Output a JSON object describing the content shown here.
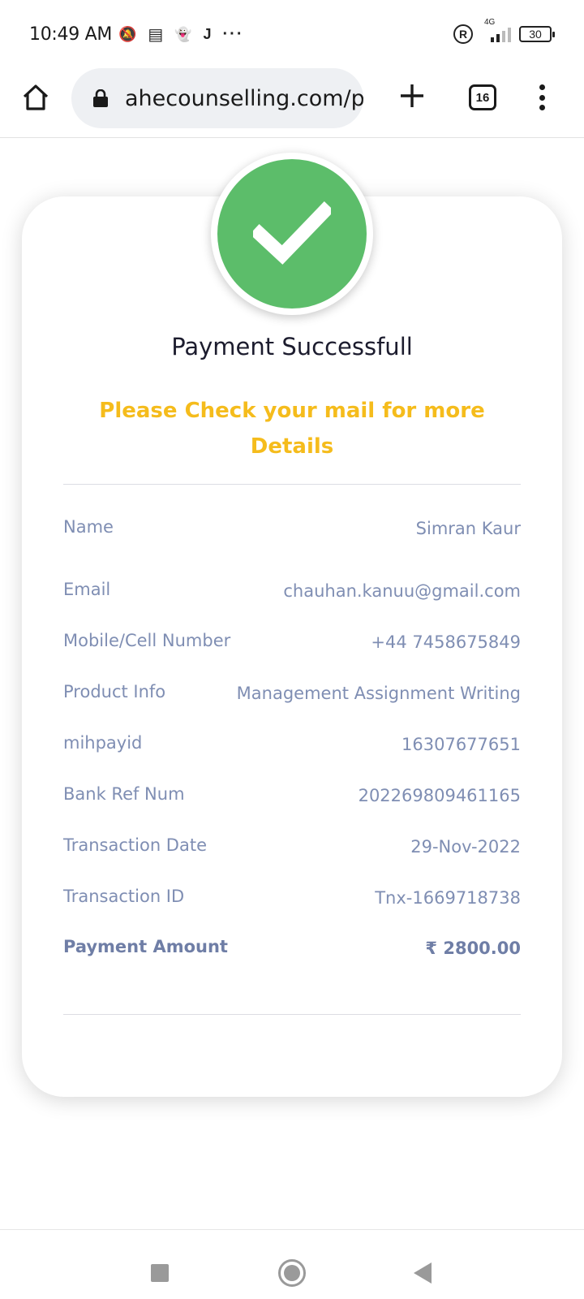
{
  "status_bar": {
    "time": "10:49 AM",
    "network": "4G",
    "battery": "30",
    "icons_left": [
      "mute-icon",
      "message-icon",
      "snapchat-icon",
      "j-icon",
      "more-icon"
    ],
    "icon_glyphs": {
      "mute": "🔕",
      "message": "▤",
      "snapchat": "👻",
      "j": "J",
      "more": "···"
    },
    "registered": "R"
  },
  "browser": {
    "url": "ahecounselling.com/p",
    "tab_count": "16"
  },
  "receipt": {
    "title": "Payment Successfull",
    "notice": "Please Check your mail for more Details",
    "rows": [
      {
        "label": "Name",
        "value": "Simran Kaur"
      },
      {
        "label": "Email",
        "value": "chauhan.kanuu@gmail.com"
      },
      {
        "label": "Mobile/Cell Number",
        "value": "+44 7458675849"
      },
      {
        "label": "Product Info",
        "value": "Management Assignment Writing"
      },
      {
        "label": "mihpayid",
        "value": "16307677651"
      },
      {
        "label": "Bank Ref Num",
        "value": "202269809461165"
      },
      {
        "label": "Transaction Date",
        "value": "29-Nov-2022"
      },
      {
        "label": "Transaction ID",
        "value": "Tnx-1669718738"
      },
      {
        "label": "Payment Amount",
        "value": "₹ 2800.00"
      }
    ]
  },
  "colors": {
    "success_green": "#5cbd6a",
    "notice_yellow": "#f5bc1c",
    "label_blue": "#7f8eb3"
  }
}
